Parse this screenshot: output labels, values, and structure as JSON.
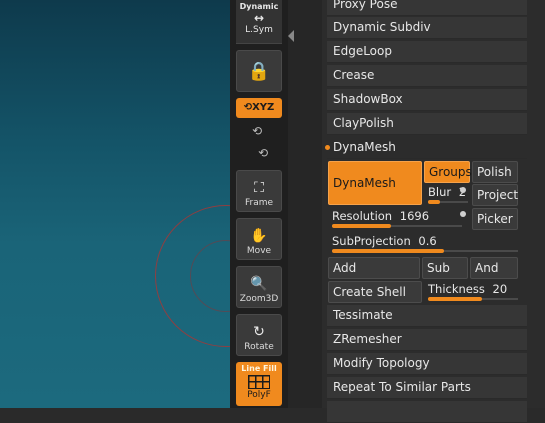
{
  "shelf": {
    "dynamic_label": "Dynamic",
    "lsym_label": "L.Sym",
    "xyz_label": "XYZ",
    "frame_label": "Frame",
    "move_label": "Move",
    "zoom_label": "Zoom3D",
    "rotate_label": "Rotate",
    "linefill_label": "Line Fill",
    "polyf_label": "PolyF"
  },
  "geometry_items_top": [
    "Proxy Pose",
    "Dynamic Subdiv",
    "EdgeLoop",
    "Crease",
    "ShadowBox",
    "ClayPolish"
  ],
  "dynamesh": {
    "header": "DynaMesh",
    "button": "DynaMesh",
    "groups": "Groups",
    "polish": "Polish",
    "blur_label": "Blur",
    "blur_value": "2",
    "project": "Project",
    "resolution_label": "Resolution",
    "resolution_value": "1696",
    "resolution_fill": 0.45,
    "picker": "Picker",
    "subprojection_label": "SubProjection",
    "subprojection_value": "0.6",
    "subprojection_fill": 0.6,
    "add": "Add",
    "sub": "Sub",
    "and": "And",
    "create_shell": "Create Shell",
    "thickness_label": "Thickness",
    "thickness_value": "20",
    "thickness_fill": 0.6
  },
  "geometry_items_bottom": [
    "Tessimate",
    "ZRemesher",
    "Modify Topology",
    "Repeat To Similar Parts"
  ],
  "colors": {
    "accent": "#f08a1e",
    "panel": "#363636",
    "viewport_top": "#0e3a4c",
    "viewport_bottom": "#1c6a7e"
  }
}
